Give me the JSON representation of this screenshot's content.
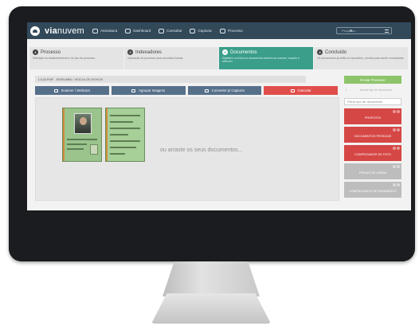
{
  "app": {
    "logo_prefix": "via",
    "logo_suffix": "nuvem"
  },
  "nav": {
    "items": [
      {
        "label": "Assinatura",
        "icon": "signature-icon"
      },
      {
        "label": "Dashboard",
        "icon": "dashboard-icon"
      },
      {
        "label": "Consultar",
        "icon": "consult-icon"
      },
      {
        "label": "Capturar",
        "icon": "capture-icon"
      },
      {
        "label": "Processo",
        "icon": "process-icon"
      }
    ],
    "search_placeholder": "Pesquisa..."
  },
  "steps": [
    {
      "num": "1",
      "title": "Processo",
      "desc": "Definição do estabelecimento e do tipo de processo."
    },
    {
      "num": "2",
      "title": "Indexadores",
      "desc": "Indexação do processo para consultas futuras."
    },
    {
      "num": "3",
      "title": "Documentos",
      "desc": "Digitalize ou insira os documentos através do scanner, arquivo e webcam."
    },
    {
      "num": "4",
      "title": "Concluído",
      "desc": "Os documentos já estão no repositório, prontos para serem consultados."
    }
  ],
  "main": {
    "breadcrumb": "LOJA FMF - MORUMBI / VEICULOS NOVOS",
    "toolbar": {
      "scanner_label": "Scanner / Webcam",
      "group_label": "Agrupar Imagens",
      "convert_label": "Converter p/ Capturar",
      "cancel_label": "Cancelar"
    },
    "drop_text": "ou arraste os seus documentos..."
  },
  "sidebar": {
    "send_label": "Enviar Processo",
    "enable_text": "Arraste tipo de documento",
    "filter_placeholder": "Filtrar tipo de documento",
    "categories": [
      {
        "label": "PROPOSTA",
        "style": "red"
      },
      {
        "label": "DOCUMENTOS PESSOAIS",
        "style": "red"
      },
      {
        "label": "COMPROVANTE DE FOTO",
        "style": "red"
      },
      {
        "label": "PEDIDO DE VENDA",
        "style": "grey"
      },
      {
        "label": "COMPROVANTE DE PAGAMENTO",
        "style": "grey"
      }
    ]
  },
  "colors": {
    "nav_bg": "#32495a",
    "active_step": "#3a9e8a",
    "toolbar_blue": "#56708a",
    "cancel_red": "#e04e4b",
    "send_green": "#8cc46a",
    "category_red": "#d54745",
    "category_grey": "#bdbdbd"
  }
}
